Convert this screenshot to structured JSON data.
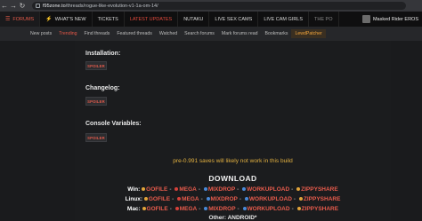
{
  "browser": {
    "url_host": "f95zone.to",
    "url_path": "/threads/rogue-like-evolution-v1-1a-om-14/",
    "back_icon": "arrow-left-icon"
  },
  "topnav": {
    "items": [
      {
        "label": "FORUMS",
        "icon": "forum-icon"
      },
      {
        "label": "WHAT'S NEW",
        "icon": "bolt-icon"
      },
      {
        "label": "TICKETS"
      },
      {
        "label": "LATEST UPDATES"
      },
      {
        "label": "NUTAKU"
      },
      {
        "label": "LIVE SEX CAMS"
      },
      {
        "label": "LIVE CAM GIRLS"
      },
      {
        "label": "THE PO"
      }
    ],
    "user": "Masked Rider EROS"
  },
  "subnav": {
    "items": [
      "New posts",
      "Trending",
      "Find threads",
      "Featured threads",
      "Watched",
      "Search forums",
      "Mark forums read",
      "Bookmarks",
      "LewdPatcher"
    ]
  },
  "sections": [
    {
      "label": "Installation:",
      "spoiler": "SPOILER"
    },
    {
      "label": "Changelog:",
      "spoiler": "SPOILER"
    },
    {
      "label": "Console Variables:",
      "spoiler": "SPOILER"
    }
  ],
  "notice": "pre-0.991 saves will likely not work in this build",
  "download": {
    "title": "DOWNLOAD",
    "rows": [
      {
        "os": "Win:",
        "links": [
          "GOFILE",
          "MEGA",
          "MIXDROP",
          "WORKUPLOAD",
          "ZIPPYSHARE"
        ]
      },
      {
        "os": "Linux:",
        "links": [
          "GOFILE",
          "MEGA",
          "MIXDROP",
          "WORKUPLOAD",
          "ZIPPYSHARE"
        ]
      },
      {
        "os": "Mac:",
        "links": [
          "GOFILE",
          "MEGA",
          "MIXDROP",
          "WORKUPLOAD",
          "ZIPPYSHARE"
        ]
      }
    ],
    "other": "Other: ANDROID*"
  },
  "colors": {
    "accent": "#e85b4c",
    "notice": "#e3b140",
    "bg": "#1a1b1d"
  }
}
